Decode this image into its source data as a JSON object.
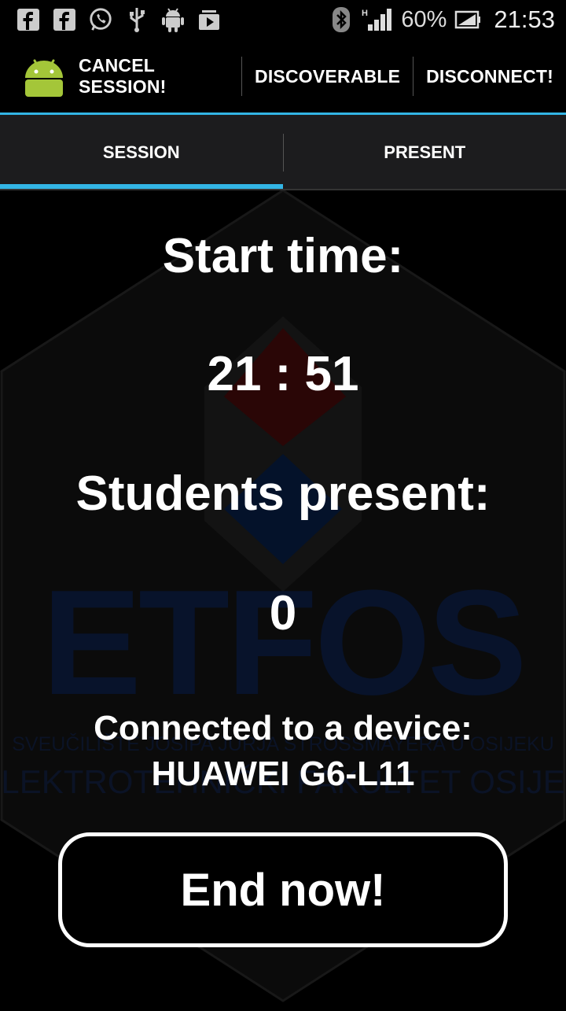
{
  "status_bar": {
    "battery_percent": "60%",
    "time": "21:53",
    "icons": [
      "facebook-icon",
      "facebook-icon",
      "whatsapp-icon",
      "usb-icon",
      "android-icon",
      "media-icon",
      "bluetooth-icon",
      "signal-icon",
      "battery-icon"
    ]
  },
  "action_bar": {
    "actions": [
      {
        "label": "CANCEL SESSION!"
      },
      {
        "label": "DISCOVERABLE"
      },
      {
        "label": "DISCONNECT!"
      }
    ]
  },
  "tabs": [
    {
      "label": "SESSION",
      "active": true
    },
    {
      "label": "PRESENT",
      "active": false
    }
  ],
  "session": {
    "start_time_label": "Start time:",
    "start_time_value": "21 : 51",
    "students_present_label": "Students present:",
    "students_present_value": "0",
    "connected_label": "Connected to a device:",
    "connected_device": "HUAWEI G6-L11",
    "end_button": "End now!"
  },
  "watermark": {
    "logo_text": "ETFOS",
    "line1": "SVEUČILIŠTE JOSIPA JURJA STROSSMAYERA U OSIJEKU",
    "line2": "ELEKTROTEHNIČKI FAKULTET OSIJEK"
  },
  "colors": {
    "accent": "#33b5e5",
    "background": "#000000",
    "tab_bar": "#1c1c1e"
  }
}
